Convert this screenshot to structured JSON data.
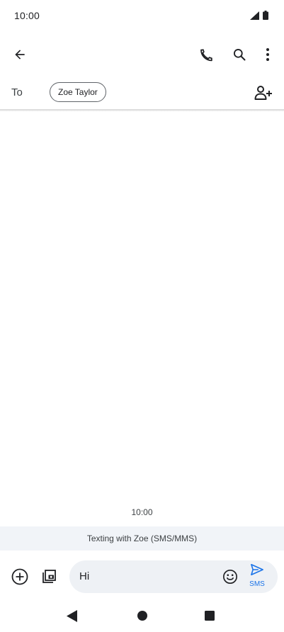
{
  "status_bar": {
    "time": "10:00",
    "icons": [
      "signal-icon",
      "battery-icon"
    ]
  },
  "app_bar": {
    "icons": [
      "back-arrow-icon",
      "phone-icon",
      "search-icon",
      "more-vert-icon"
    ]
  },
  "recipient": {
    "to_label": "To",
    "chip_name": "Zoe Taylor",
    "add_icon": "add-person-icon"
  },
  "conversation": {
    "timestamp": "10:00",
    "banner": "Texting with Zoe (SMS/MMS)"
  },
  "compose": {
    "attach_icon": "add-circle-icon",
    "gallery_icon": "gallery-icon",
    "message_text": "Hi",
    "emoji_icon": "emoji-icon",
    "send_icon": "send-icon",
    "send_label": "SMS"
  },
  "nav_bar": {
    "icons": [
      "back-triangle-icon",
      "home-circle-icon",
      "recents-square-icon"
    ]
  },
  "colors": {
    "accent": "#1a73e8",
    "banner_bg": "#f1f4f8",
    "compose_bg": "#eef1f5"
  }
}
